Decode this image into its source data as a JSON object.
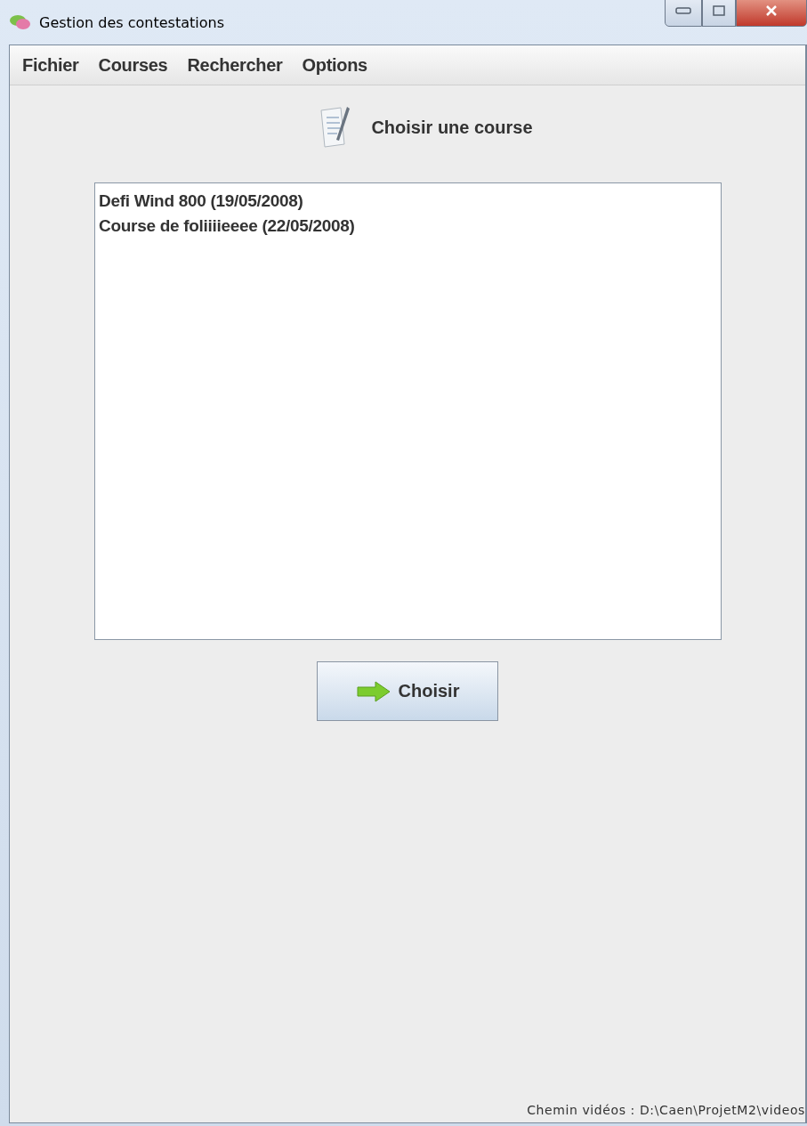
{
  "window": {
    "title": "Gestion des contestations"
  },
  "menu": [
    {
      "label": "Fichier"
    },
    {
      "label": "Courses"
    },
    {
      "label": "Rechercher"
    },
    {
      "label": "Options"
    }
  ],
  "header": {
    "title": "Choisir une course"
  },
  "races": [
    {
      "label": "Defi Wind 800 (19/05/2008)",
      "selected": false
    },
    {
      "label": "Course de foliiiieeee (22/05/2008)",
      "selected": false
    }
  ],
  "button": {
    "label": "Choisir"
  },
  "status_bar": {
    "text": "Chemin vidéos : D:\\Caen\\ProjetM2\\videos"
  }
}
